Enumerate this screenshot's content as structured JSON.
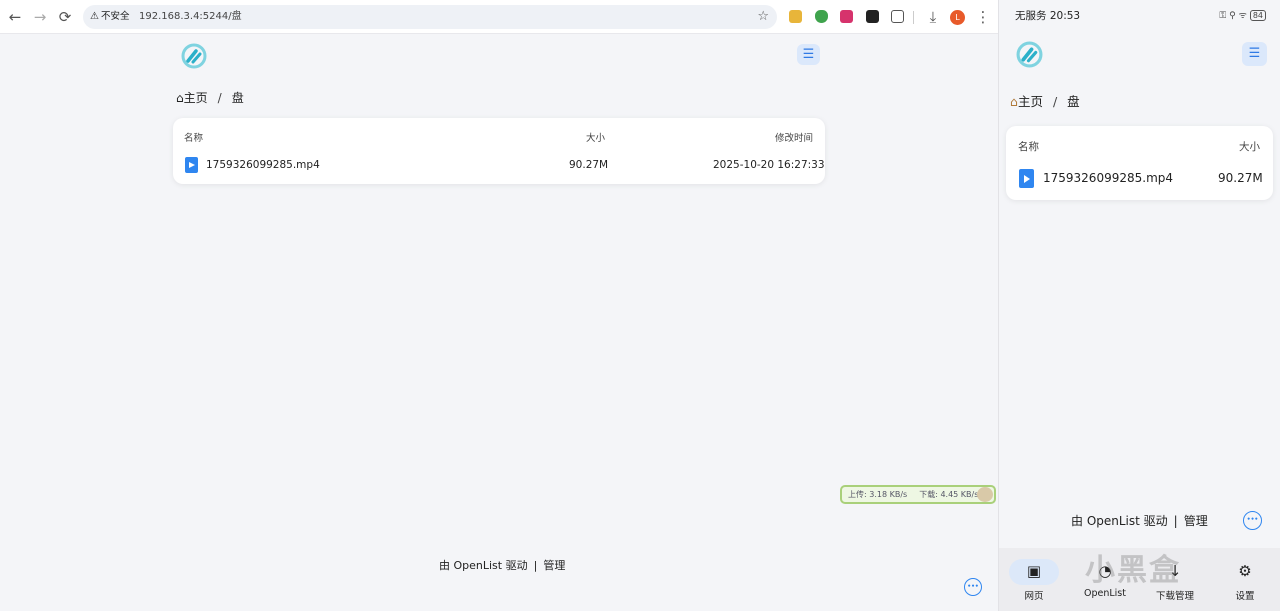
{
  "browser": {
    "nav": {
      "back": "←",
      "forward": "→",
      "reload": "⟳"
    },
    "omnibox": {
      "security_icon": "warning-triangle-icon",
      "security_label": "不安全",
      "url": "192.168.3.4:5244/盘",
      "star": "☆"
    },
    "download_icon": "⤓",
    "avatar_letter": "L",
    "more": "⋮",
    "accent_color": "#2f86f0"
  },
  "page": {
    "breadcrumb": {
      "home": "主页",
      "separator": "/",
      "current": "盘"
    },
    "table": {
      "headers": {
        "name": "名称",
        "size": "大小",
        "modified": "修改时间"
      },
      "rows": [
        {
          "name": "1759326099285.mp4",
          "size": "90.27M",
          "modified": "2025-10-20 16:27:33"
        }
      ]
    },
    "footer": {
      "powered": "由 OpenList 驱动",
      "separator": "|",
      "manage": "管理"
    },
    "more_icon": "•••"
  },
  "speed_widget": {
    "upload": "上传: 3.18 KB/s",
    "download": "下载: 4.45 KB/s"
  },
  "phone": {
    "status_left": "无服务 20:53",
    "status_right": "⚿ ⚲ ᯤ",
    "battery": "84",
    "breadcrumb": {
      "home": "主页",
      "separator": "/",
      "current": "盘"
    },
    "table": {
      "headers": {
        "name": "名称",
        "size": "大小"
      },
      "rows": [
        {
          "name": "1759326099285.mp4",
          "size": "90.27M"
        }
      ]
    },
    "footer": {
      "powered": "由 OpenList 驱动",
      "separator": "|",
      "manage": "管理"
    },
    "bottom_nav": [
      {
        "label": "网页",
        "icon": "▣"
      },
      {
        "label": "OpenList",
        "icon": "◔"
      },
      {
        "label": "下载管理",
        "icon": "↓"
      },
      {
        "label": "设置",
        "icon": "⚙"
      }
    ],
    "watermark": "小黑盒"
  }
}
